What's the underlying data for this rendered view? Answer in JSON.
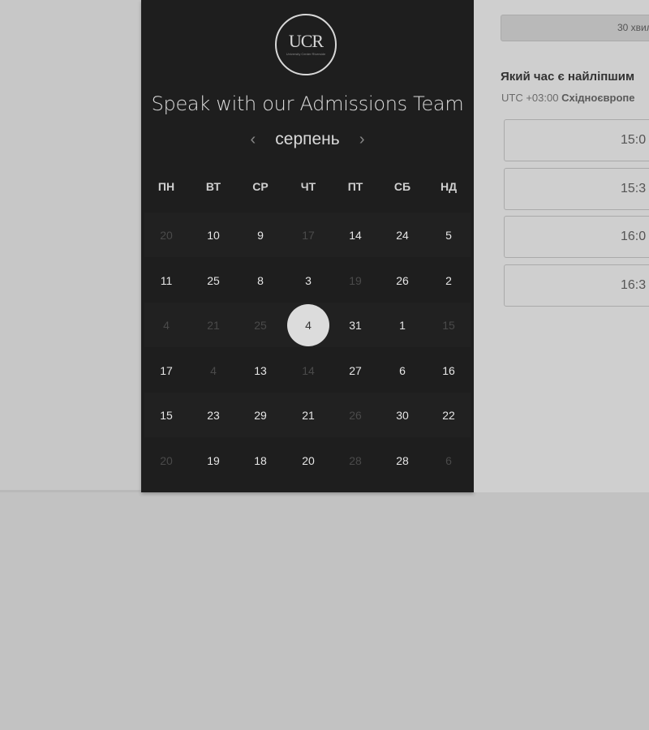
{
  "colors": {
    "panel_dark": "#1e1e1e",
    "panel_light": "#cfcfcf",
    "selected_day": "#dcdcdc",
    "backdrop": "#c2c2c2"
  },
  "logo": {
    "text": "UCR",
    "subtitle": "University Center Riverside"
  },
  "heading": "Speak with our Admissions Team",
  "calendar": {
    "month": "серпень",
    "prev_icon": "chevron-left-icon",
    "next_icon": "chevron-right-icon",
    "weekdays": [
      "ПН",
      "ВТ",
      "СР",
      "ЧТ",
      "ПТ",
      "СБ",
      "НД"
    ],
    "rows": [
      [
        {
          "d": "20",
          "dim": true
        },
        {
          "d": "10"
        },
        {
          "d": "9"
        },
        {
          "d": "17",
          "dim": true
        },
        {
          "d": "14"
        },
        {
          "d": "24"
        },
        {
          "d": "5"
        }
      ],
      [
        {
          "d": "11"
        },
        {
          "d": "25"
        },
        {
          "d": "8"
        },
        {
          "d": "3"
        },
        {
          "d": "19",
          "dim": true
        },
        {
          "d": "26"
        },
        {
          "d": "2"
        }
      ],
      [
        {
          "d": "4",
          "dim": true
        },
        {
          "d": "21",
          "dim": true
        },
        {
          "d": "25",
          "dim": true
        },
        {
          "d": "4",
          "selected": true
        },
        {
          "d": "31"
        },
        {
          "d": "1"
        },
        {
          "d": "15",
          "dim": true
        }
      ],
      [
        {
          "d": "17"
        },
        {
          "d": "4",
          "dim": true
        },
        {
          "d": "13"
        },
        {
          "d": "14",
          "dim": true
        },
        {
          "d": "27"
        },
        {
          "d": "6"
        },
        {
          "d": "16"
        }
      ],
      [
        {
          "d": "15"
        },
        {
          "d": "23"
        },
        {
          "d": "29"
        },
        {
          "d": "21"
        },
        {
          "d": "26",
          "dim": true
        },
        {
          "d": "30"
        },
        {
          "d": "22"
        }
      ],
      [
        {
          "d": "20",
          "dim": true
        },
        {
          "d": "19"
        },
        {
          "d": "18"
        },
        {
          "d": "20"
        },
        {
          "d": "28",
          "dim": true
        },
        {
          "d": "28"
        },
        {
          "d": "6",
          "dim": true
        }
      ]
    ]
  },
  "scheduler": {
    "duration": "30 хвил",
    "question": "Який час є найліпшим",
    "timezone_offset": "UTC +03:00",
    "timezone_name": "Східноєвропе",
    "slots": [
      "15:0",
      "15:3",
      "16:0",
      "16:3"
    ]
  }
}
